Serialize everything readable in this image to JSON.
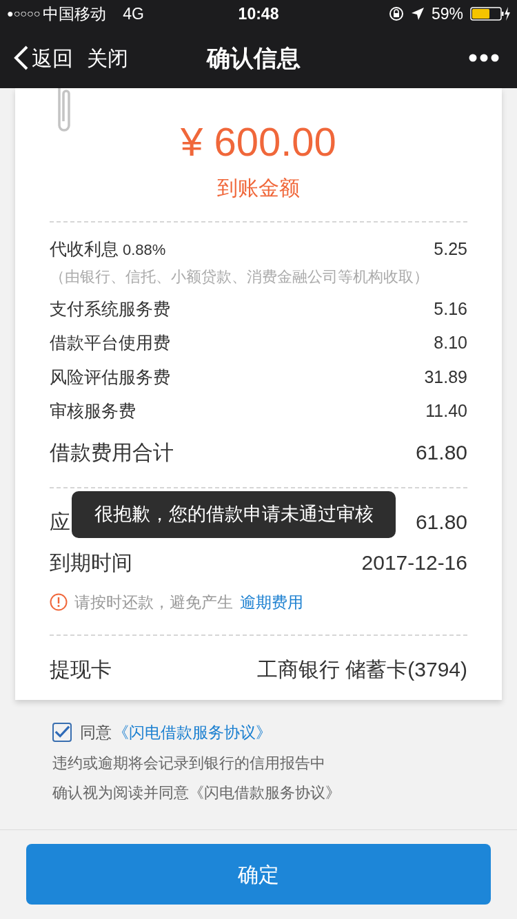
{
  "status_bar": {
    "signal": "●○○○○",
    "carrier": "中国移动",
    "network": "4G",
    "time": "10:48",
    "battery": "59%"
  },
  "nav": {
    "back": "返回",
    "close": "关闭",
    "title": "确认信息"
  },
  "amount": {
    "value": "¥ 600.00",
    "label": "到账金额"
  },
  "fees": [
    {
      "label": "代收利息",
      "rate": "0.88%",
      "value": "5.25",
      "note": "（由银行、信托、小额贷款、消费金融公司等机构收取）"
    },
    {
      "label": "支付系统服务费",
      "value": "5.16"
    },
    {
      "label": "借款平台使用费",
      "value": "8.10"
    },
    {
      "label": "风险评估服务费",
      "value": "31.89"
    },
    {
      "label": "审核服务费",
      "value": "11.40"
    }
  ],
  "total": {
    "label": "借款费用合计",
    "value": "61.80"
  },
  "repayment": [
    {
      "label": "应",
      "value": "61.80"
    },
    {
      "label": "到期时间",
      "value": "2017-12-16"
    }
  ],
  "notice": {
    "text": "请按时还款，避免产生",
    "link": "逾期费用"
  },
  "withdraw_card": {
    "label": "提现卡",
    "value": "工商银行 储蓄卡(3794)"
  },
  "agreement": {
    "checked": true,
    "text": "同意",
    "link": "《闪电借款服务协议》",
    "notes": [
      "违约或逾期将会记录到银行的信用报告中",
      "确认视为阅读并同意《闪电借款服务协议》"
    ]
  },
  "toast": "很抱歉，您的借款申请未通过审核",
  "confirm_button": "确定"
}
